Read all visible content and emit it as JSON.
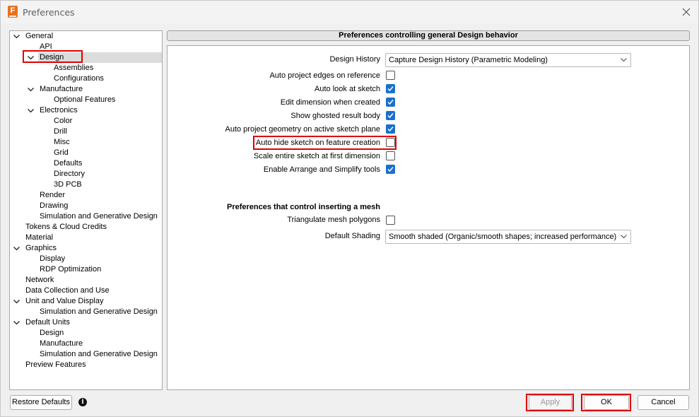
{
  "window": {
    "title": "Preferences",
    "app_icon_letter": "F"
  },
  "tree": [
    {
      "label": "General",
      "level": 0,
      "expanded": true
    },
    {
      "label": "API",
      "level": 1
    },
    {
      "label": "Design",
      "level": 1,
      "expanded": true,
      "selected": true
    },
    {
      "label": "Assemblies",
      "level": 2
    },
    {
      "label": "Configurations",
      "level": 2
    },
    {
      "label": "Manufacture",
      "level": 1,
      "expanded": true
    },
    {
      "label": "Optional Features",
      "level": 2
    },
    {
      "label": "Electronics",
      "level": 1,
      "expanded": true
    },
    {
      "label": "Color",
      "level": 2
    },
    {
      "label": "Drill",
      "level": 2
    },
    {
      "label": "Misc",
      "level": 2
    },
    {
      "label": "Grid",
      "level": 2
    },
    {
      "label": "Defaults",
      "level": 2
    },
    {
      "label": "Directory",
      "level": 2
    },
    {
      "label": "3D PCB",
      "level": 2
    },
    {
      "label": "Render",
      "level": 1
    },
    {
      "label": "Drawing",
      "level": 1
    },
    {
      "label": "Simulation and Generative Design",
      "level": 1
    },
    {
      "label": "Tokens & Cloud Credits",
      "level": 0
    },
    {
      "label": "Material",
      "level": 0
    },
    {
      "label": "Graphics",
      "level": 0,
      "expanded": true
    },
    {
      "label": "Display",
      "level": 1
    },
    {
      "label": "RDP Optimization",
      "level": 1
    },
    {
      "label": "Network",
      "level": 0
    },
    {
      "label": "Data Collection and Use",
      "level": 0
    },
    {
      "label": "Unit and Value Display",
      "level": 0,
      "expanded": true
    },
    {
      "label": "Simulation and Generative Design",
      "level": 1
    },
    {
      "label": "Default Units",
      "level": 0,
      "expanded": true
    },
    {
      "label": "Design",
      "level": 1
    },
    {
      "label": "Manufacture",
      "level": 1
    },
    {
      "label": "Simulation and Generative Design",
      "level": 1
    },
    {
      "label": "Preview Features",
      "level": 0
    }
  ],
  "panel": {
    "header": "Preferences controlling general Design behavior",
    "design_history": {
      "label": "Design History",
      "value": "Capture Design History (Parametric Modeling)"
    },
    "options": [
      {
        "label": "Auto project edges on reference",
        "checked": false
      },
      {
        "label": "Auto look at sketch",
        "checked": true
      },
      {
        "label": "Edit dimension when created",
        "checked": true
      },
      {
        "label": "Show ghosted result body",
        "checked": true
      },
      {
        "label": "Auto project geometry on active sketch plane",
        "checked": true
      },
      {
        "label": "Auto hide sketch on feature creation",
        "checked": false
      },
      {
        "label": "Scale entire sketch at first dimension",
        "checked": false
      },
      {
        "label": "Enable Arrange and Simplify tools",
        "checked": true
      }
    ],
    "mesh_section": {
      "title": "Preferences that control inserting a mesh",
      "triangulate": {
        "label": "Triangulate mesh polygons",
        "checked": false
      },
      "default_shading": {
        "label": "Default Shading",
        "value": "Smooth shaded (Organic/smooth shapes; increased performance)"
      }
    }
  },
  "buttons": {
    "restore_defaults": "Restore Defaults",
    "apply": "Apply",
    "ok": "OK",
    "cancel": "Cancel",
    "info_glyph": "i"
  },
  "colors": {
    "highlight": "#e00000",
    "checkbox_checked": "#1a6fcf",
    "app_icon": "#e8721c"
  }
}
